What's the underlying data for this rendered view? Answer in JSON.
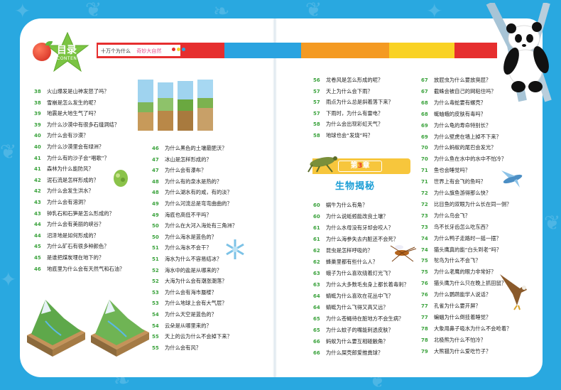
{
  "header": {
    "toc_title": "目录",
    "toc_subtitle": "CONTENTS",
    "book_title": "十万个为什么",
    "book_subtitle": "奇妙大自然"
  },
  "colors": {
    "background": "#29a8e0",
    "header_red": "#e62e2e",
    "header_blue": "#2aa3e0",
    "header_orange": "#f49a22",
    "header_yellow": "#f9d224",
    "number_green": "#3aa23c",
    "chapter_yellow": "#f7c63c",
    "chapter_name_blue": "#1e9fd6"
  },
  "chapter": {
    "label_pre": "第",
    "number": "3",
    "label_post": "章",
    "name": "生物揭秘"
  },
  "toc_col1": [
    {
      "num": "38",
      "text": "火山爆发是山神发怒了吗？"
    },
    {
      "num": "38",
      "text": "雪崩是怎么发生的呢？"
    },
    {
      "num": "39",
      "text": "地震是大地生气了吗？"
    },
    {
      "num": "39",
      "text": "为什么沙漠中有很多石缝洞结？"
    },
    {
      "num": "40",
      "text": "为什么会有沙漠？"
    },
    {
      "num": "40",
      "text": "为什么沙漠里会有绿洲？"
    },
    {
      "num": "41",
      "text": "为什么有的沙子会“唱歌”？"
    },
    {
      "num": "41",
      "text": "森林为什么能防风？"
    },
    {
      "num": "42",
      "text": "泥石流是怎样形成的？"
    },
    {
      "num": "42",
      "text": "为什么会发生洪水？"
    },
    {
      "num": "43",
      "text": "为什么会有溶洞？"
    },
    {
      "num": "43",
      "text": "钟乳石和石笋是怎么形成的？"
    },
    {
      "num": "44",
      "text": "为什么会有美丽的峡谷？"
    },
    {
      "num": "44",
      "text": "沼泽地是如何形成的？"
    },
    {
      "num": "45",
      "text": "为什么矿石有很多种颜色？"
    },
    {
      "num": "45",
      "text": "是谁把煤炭埋在地下的？"
    },
    {
      "num": "46",
      "text": "地底里为什么会有天然气和石油？"
    }
  ],
  "toc_col2": [
    {
      "num": "46",
      "text": "为什么黑色的土壤最肥沃？"
    },
    {
      "num": "47",
      "text": "冰山是怎样形成的？"
    },
    {
      "num": "47",
      "text": "为什么会有瀑布？"
    },
    {
      "num": "48",
      "text": "为什么有的泉水是热的？"
    },
    {
      "num": "48",
      "text": "为什么湖水有的咸，有的淡？"
    },
    {
      "num": "49",
      "text": "为什么河流总是弯弯曲曲的？"
    },
    {
      "num": "49",
      "text": "海底也高低不平吗？"
    },
    {
      "num": "50",
      "text": "为什么在大河入海处有三角洲？"
    },
    {
      "num": "50",
      "text": "为什么海水是蓝色的？"
    },
    {
      "num": "51",
      "text": "为什么海水不会干？"
    },
    {
      "num": "51",
      "text": "海水为什么不容易结冰？"
    },
    {
      "num": "52",
      "text": "海水中的盐是从哪来的？"
    },
    {
      "num": "52",
      "text": "大海为什么会有潮涨潮落？"
    },
    {
      "num": "53",
      "text": "为什么会有海市蜃楼？"
    },
    {
      "num": "53",
      "text": "为什么地球上会有大气层？"
    },
    {
      "num": "54",
      "text": "为什么天空是蓝色的？"
    },
    {
      "num": "54",
      "text": "云朵是从哪里来的？"
    },
    {
      "num": "55",
      "text": "天上的云为什么不会掉下来？"
    },
    {
      "num": "55",
      "text": "为什么会有风？"
    }
  ],
  "toc_col3a": [
    {
      "num": "56",
      "text": "龙卷风是怎么形成的呢？"
    },
    {
      "num": "57",
      "text": "天上为什么会下雨？"
    },
    {
      "num": "57",
      "text": "雨点为什么总是斜着落下来？"
    },
    {
      "num": "57",
      "text": "下雨时，为什么有雷电？"
    },
    {
      "num": "58",
      "text": "为什么会出现彩虹天气？"
    },
    {
      "num": "58",
      "text": "地球也会“发烧”吗？"
    }
  ],
  "toc_col3b": [
    {
      "num": "60",
      "text": "蜗牛为什么有角？"
    },
    {
      "num": "60",
      "text": "为什么说蚯蚓能改良土壤？"
    },
    {
      "num": "61",
      "text": "为什么水母没有牙却会咬人？"
    },
    {
      "num": "61",
      "text": "为什么海参失去内脏还不会死？"
    },
    {
      "num": "62",
      "text": "昆虫是怎样呼吸的？"
    },
    {
      "num": "62",
      "text": "蜂巢里都有些什么人？"
    },
    {
      "num": "63",
      "text": "蛾子为什么喜欢绕着灯光飞？"
    },
    {
      "num": "63",
      "text": "为什么大多数毛虫身上都长着毒刺？"
    },
    {
      "num": "64",
      "text": "蜻蜓为什么喜欢在花丛中飞？"
    },
    {
      "num": "64",
      "text": "蜻蜓为什么飞得又高又远？"
    },
    {
      "num": "65",
      "text": "为什么苍蝇待在脏地方不会生病？"
    },
    {
      "num": "65",
      "text": "为什么蚊子的嘴能刺透皮肤？"
    },
    {
      "num": "66",
      "text": "蚂蚁为什么要互相碰触角？"
    },
    {
      "num": "66",
      "text": "为什么屎壳郎爱推粪球？"
    }
  ],
  "toc_col4": [
    {
      "num": "67",
      "text": "放屁虫为什么要放臭屁？"
    },
    {
      "num": "67",
      "text": "截蛛会被自己的网粘住吗？"
    },
    {
      "num": "68",
      "text": "为什么毒蛇要有螺壳？"
    },
    {
      "num": "68",
      "text": "蜒蚰蛾的皮肤有毒吗？"
    },
    {
      "num": "69",
      "text": "为什么龟的寿命特别长？"
    },
    {
      "num": "69",
      "text": "为什么壁虎在墙上掉不下来？"
    },
    {
      "num": "70",
      "text": "为什么蚂蚁的尾巴会发光？"
    },
    {
      "num": "70",
      "text": "为什么鱼在水中的水中不怕冷？"
    },
    {
      "num": "71",
      "text": "鱼也会睡觉吗？"
    },
    {
      "num": "71",
      "text": "世界上有会飞的鱼吗？"
    },
    {
      "num": "72",
      "text": "为什么旗鱼游得那么快？"
    },
    {
      "num": "72",
      "text": "比目鱼的双眼为什么长在同一侧？"
    },
    {
      "num": "73",
      "text": "为什么鸟会飞？"
    },
    {
      "num": "73",
      "text": "鸟不长牙齿怎么吃东西？"
    },
    {
      "num": "74",
      "text": "为什么鸭子走路时一摇一摆？"
    },
    {
      "num": "74",
      "text": "猫头鹰真的能“白头到老”吗？"
    },
    {
      "num": "75",
      "text": "鸵鸟为什么不会飞？"
    },
    {
      "num": "75",
      "text": "为什么老鹰的眼力非常好？"
    },
    {
      "num": "76",
      "text": "猫头鹰为什么只在晚上抓田鼠？"
    },
    {
      "num": "76",
      "text": "为什么鹦鹉能学人说话？"
    },
    {
      "num": "77",
      "text": "孔雀为什么要开屏？"
    },
    {
      "num": "77",
      "text": "蝙蝠为什么倒挂着睡觉？"
    },
    {
      "num": "78",
      "text": "大象用鼻子吸水为什么不会呛着？"
    },
    {
      "num": "78",
      "text": "北极熊为什么不怕冷？"
    },
    {
      "num": "79",
      "text": "大熊猫为什么爱吃竹子？"
    }
  ]
}
